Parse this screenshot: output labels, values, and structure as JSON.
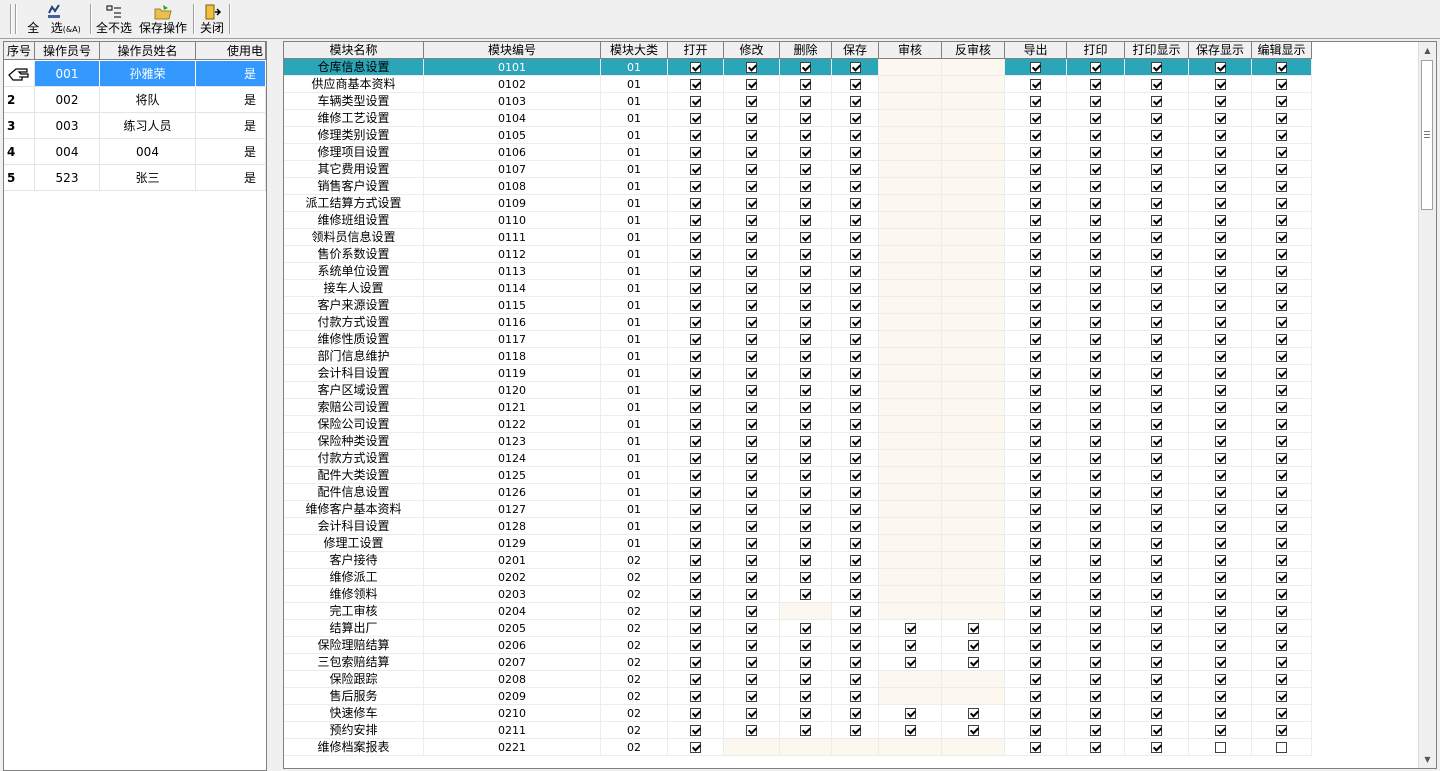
{
  "toolbar": {
    "select_all_label": "全",
    "select_label": "选",
    "select_hotkey": "(&A)",
    "select_none_label": "全不选",
    "save_label": "保存操作",
    "close_label": "关闭"
  },
  "operators": {
    "columns": [
      "序号",
      "操作员号",
      "操作员姓名",
      "使用电"
    ],
    "rows": [
      {
        "seq": "",
        "id": "001",
        "name": "孙雅荣",
        "use": "是"
      },
      {
        "seq": "2",
        "id": "002",
        "name": "将队",
        "use": "是"
      },
      {
        "seq": "3",
        "id": "003",
        "name": "练习人员",
        "use": "是"
      },
      {
        "seq": "4",
        "id": "004",
        "name": "004",
        "use": "是"
      },
      {
        "seq": "5",
        "id": "523",
        "name": "张三",
        "use": "是"
      }
    ]
  },
  "modules": {
    "columns": [
      "模块名称",
      "模块编号",
      "模块大类",
      "打开",
      "修改",
      "删除",
      "保存",
      "审核",
      "反审核",
      "导出",
      "打印",
      "打印显示",
      "保存显示",
      "编辑显示"
    ],
    "rows": [
      {
        "name": "仓库信息设置",
        "code": "0101",
        "cat": "01",
        "p": "1111xx11111"
      },
      {
        "name": "供应商基本资料",
        "code": "0102",
        "cat": "01",
        "p": "1111xx11111"
      },
      {
        "name": "车辆类型设置",
        "code": "0103",
        "cat": "01",
        "p": "1111xx11111"
      },
      {
        "name": "维修工艺设置",
        "code": "0104",
        "cat": "01",
        "p": "1111xx11111"
      },
      {
        "name": "修理类别设置",
        "code": "0105",
        "cat": "01",
        "p": "1111xx11111"
      },
      {
        "name": "修理项目设置",
        "code": "0106",
        "cat": "01",
        "p": "1111xx11111"
      },
      {
        "name": "其它费用设置",
        "code": "0107",
        "cat": "01",
        "p": "1111xx11111"
      },
      {
        "name": "销售客户设置",
        "code": "0108",
        "cat": "01",
        "p": "1111xx11111"
      },
      {
        "name": "派工结算方式设置",
        "code": "0109",
        "cat": "01",
        "p": "1111xx11111"
      },
      {
        "name": "维修班组设置",
        "code": "0110",
        "cat": "01",
        "p": "1111xx11111"
      },
      {
        "name": "领料员信息设置",
        "code": "0111",
        "cat": "01",
        "p": "1111xx11111"
      },
      {
        "name": "售价系数设置",
        "code": "0112",
        "cat": "01",
        "p": "1111xx11111"
      },
      {
        "name": "系统单位设置",
        "code": "0113",
        "cat": "01",
        "p": "1111xx11111"
      },
      {
        "name": "接车人设置",
        "code": "0114",
        "cat": "01",
        "p": "1111xx11111"
      },
      {
        "name": "客户来源设置",
        "code": "0115",
        "cat": "01",
        "p": "1111xx11111"
      },
      {
        "name": "付款方式设置",
        "code": "0116",
        "cat": "01",
        "p": "1111xx11111"
      },
      {
        "name": "维修性质设置",
        "code": "0117",
        "cat": "01",
        "p": "1111xx11111"
      },
      {
        "name": "部门信息维护",
        "code": "0118",
        "cat": "01",
        "p": "1111xx11111"
      },
      {
        "name": "会计科目设置",
        "code": "0119",
        "cat": "01",
        "p": "1111xx11111"
      },
      {
        "name": "客户区域设置",
        "code": "0120",
        "cat": "01",
        "p": "1111xx11111"
      },
      {
        "name": "索赔公司设置",
        "code": "0121",
        "cat": "01",
        "p": "1111xx11111"
      },
      {
        "name": "保险公司设置",
        "code": "0122",
        "cat": "01",
        "p": "1111xx11111"
      },
      {
        "name": "保险种类设置",
        "code": "0123",
        "cat": "01",
        "p": "1111xx11111"
      },
      {
        "name": "付款方式设置",
        "code": "0124",
        "cat": "01",
        "p": "1111xx11111"
      },
      {
        "name": "配件大类设置",
        "code": "0125",
        "cat": "01",
        "p": "1111xx11111"
      },
      {
        "name": "配件信息设置",
        "code": "0126",
        "cat": "01",
        "p": "1111xx11111"
      },
      {
        "name": "维修客户基本资料",
        "code": "0127",
        "cat": "01",
        "p": "1111xx11111"
      },
      {
        "name": "会计科目设置",
        "code": "0128",
        "cat": "01",
        "p": "1111xx11111"
      },
      {
        "name": "修理工设置",
        "code": "0129",
        "cat": "01",
        "p": "1111xx11111"
      },
      {
        "name": "客户接待",
        "code": "0201",
        "cat": "02",
        "p": "1111xx11111"
      },
      {
        "name": "维修派工",
        "code": "0202",
        "cat": "02",
        "p": "1111xx11111"
      },
      {
        "name": "维修领料",
        "code": "0203",
        "cat": "02",
        "p": "1111xx11111"
      },
      {
        "name": "完工审核",
        "code": "0204",
        "cat": "02",
        "p": "11x1xx11111"
      },
      {
        "name": "结算出厂",
        "code": "0205",
        "cat": "02",
        "p": "11111111111"
      },
      {
        "name": "保险理赔结算",
        "code": "0206",
        "cat": "02",
        "p": "11111111111"
      },
      {
        "name": "三包索赔结算",
        "code": "0207",
        "cat": "02",
        "p": "11111111111"
      },
      {
        "name": "保险跟踪",
        "code": "0208",
        "cat": "02",
        "p": "1111xx11111"
      },
      {
        "name": "售后服务",
        "code": "0209",
        "cat": "02",
        "p": "1111xx11111"
      },
      {
        "name": "快速修车",
        "code": "0210",
        "cat": "02",
        "p": "11111111111"
      },
      {
        "name": "预约安排",
        "code": "0211",
        "cat": "02",
        "p": "11111111111"
      },
      {
        "name": "维修档案报表",
        "code": "0221",
        "cat": "02",
        "p": "1xxxxx11100"
      }
    ]
  }
}
